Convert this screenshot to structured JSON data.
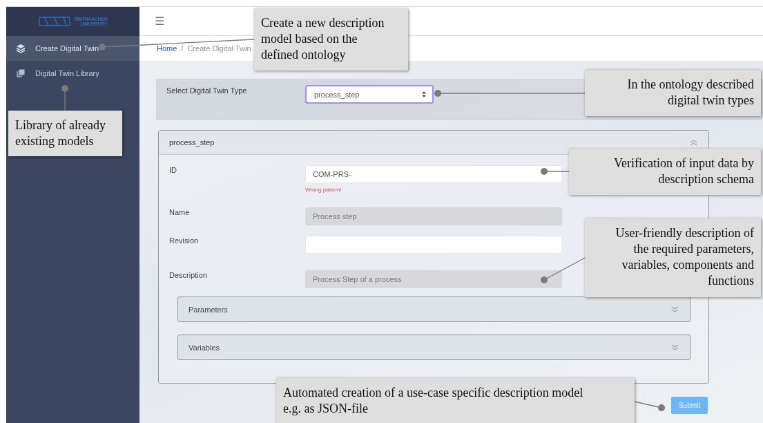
{
  "sidebar": {
    "logo_lines": [
      "RWTHAACHEN",
      "UNIVERSITY"
    ],
    "items": [
      {
        "label": "Create Digital Twin",
        "selected": true
      },
      {
        "label": "Digital Twin Library",
        "selected": false
      }
    ]
  },
  "topbar": {
    "menu_icon": "☰"
  },
  "breadcrumb": [
    {
      "label": "Home",
      "kind": "link"
    },
    {
      "label": "/",
      "kind": "separator"
    },
    {
      "label": "Create Digital Twin",
      "kind": "current"
    }
  ],
  "type_select": {
    "label": "Select Digital Twin Type",
    "value": "process_step"
  },
  "panel": {
    "title": "process_step",
    "expanded": true,
    "fields": [
      {
        "label": "ID",
        "value": "COM-PRS-",
        "disabled": false,
        "error": "Wrong pattern!"
      },
      {
        "label": "Name",
        "value": "Process step",
        "disabled": true
      },
      {
        "label": "Revision",
        "disabled": false
      },
      {
        "label": "Description",
        "value": "Process Step of a process",
        "disabled": true
      }
    ],
    "sections": [
      {
        "title": "Parameters",
        "expanded": false
      },
      {
        "title": "Variables",
        "expanded": false
      }
    ]
  },
  "submit": "Submit",
  "annotations": [
    {
      "lines": [
        "Create a new description",
        "model based on the",
        "defined ontology"
      ]
    },
    {
      "lines": [
        "Library of already",
        "existing models"
      ]
    },
    {
      "lines": [
        "In the ontology described",
        "digital twin types"
      ]
    },
    {
      "lines": [
        "Verification of input data by",
        "description schema"
      ]
    },
    {
      "lines": [
        "User-friendly description of",
        "the required parameters,",
        "variables, components and",
        "functions"
      ]
    },
    {
      "lines": [
        "Automated creation of a use-case specific description model",
        "e.g. as JSON-file"
      ]
    }
  ]
}
